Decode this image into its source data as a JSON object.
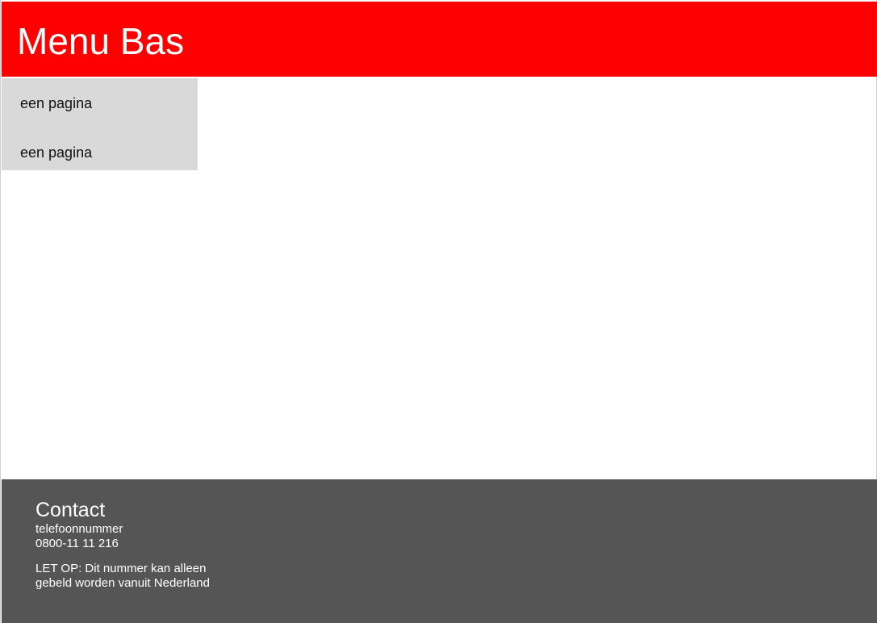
{
  "header": {
    "title": "Menu Bas"
  },
  "sidebar": {
    "items": [
      {
        "label": "een pagina"
      },
      {
        "label": "een pagina"
      }
    ]
  },
  "footer": {
    "contact_title": "Contact",
    "phone_label": "telefoonnummer",
    "phone_number": "0800-11 11 216",
    "note": "LET OP: Dit nummer kan alleen gebeld worden vanuit Nederland"
  },
  "colors": {
    "header_bg": "#ff0000",
    "sidebar_bg": "#d9d9d9",
    "footer_bg": "#555555"
  }
}
